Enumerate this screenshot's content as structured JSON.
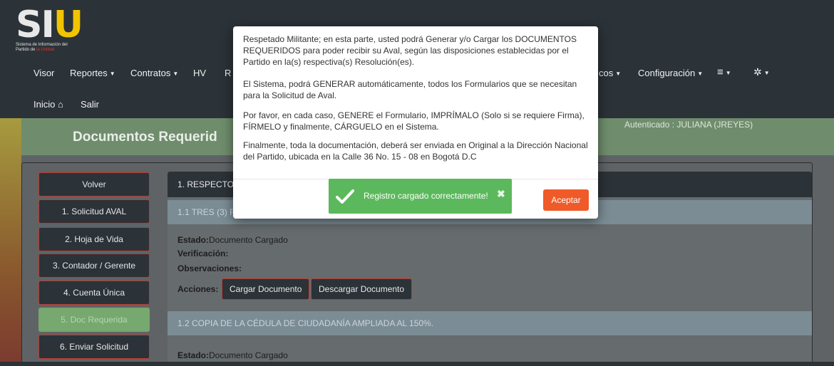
{
  "logo": {
    "letters_s": "S",
    "letters_i": "I",
    "letters_u": "U",
    "sub_line1": "Sistema de Información del",
    "sub_line2_prefix": "Partido de ",
    "sub_line2_highlight": "la Unidad"
  },
  "nav": {
    "visor": "Visor",
    "reportes": "Reportes",
    "contratos": "Contratos",
    "hv": "HV",
    "r_partial": "R",
    "cos_partial": "cos",
    "configuracion": "Configuración",
    "inicio": "Inicio",
    "salir": "Salir"
  },
  "header": {
    "title": "Documentos Requerid",
    "auth": "Autenticado : JULIANA (JREYES)"
  },
  "sidebar": {
    "items": [
      {
        "label": "Volver"
      },
      {
        "label": "1. Solicitud AVAL"
      },
      {
        "label": "2. Hoja de Vida"
      },
      {
        "label": "3. Contador / Gerente"
      },
      {
        "label": "4. Cuenta Única"
      },
      {
        "label": "5. Doc Requerida"
      },
      {
        "label": "6. Enviar Solicitud"
      }
    ]
  },
  "panel": {
    "head": "1. RESPECTO",
    "section1_title": "1.1 TRES (3) F",
    "estado_label": "Estado:",
    "estado_value": "Documento Cargado",
    "verificacion_label": "Verificación:",
    "observaciones_label": "Observaciones:",
    "acciones_label": "Acciones:",
    "cargar": "Cargar Documento",
    "descargar": "Descargar Documento",
    "section2_title": "1.2 COPIA DE LA CÉDULA DE CIUDADANÍA AMPLIADA AL 150%.",
    "estado2_label": "Estado:",
    "estado2_value": "Documento Cargado"
  },
  "modal": {
    "p1": "Respetado Militante; en esta parte, usted podrá Generar y/o Cargar los DOCUMENTOS REQUERIDOS para poder recibir su Aval, según las disposiciones establecidas por el Partido en la(s) respectiva(s) Resolución(es).",
    "p2": "El Sistema, podrá GENERAR automáticamente, todos los Formularios que se necesitan para la Solicitud de Aval.",
    "p3": "Por favor, en cada caso, GENERE el Formulario, IMPRÍMALO (Solo si se requiere Firma), FÍRMELO y finalmente, CÁRGUELO en el Sistema.",
    "p4": "Finalmente, toda la documentación, deberá ser enviada en Original a la Dirección Nacional del Partido, ubicada en la Calle 36 No. 15 - 08 en Bogotá D.C",
    "accept": "Aceptar"
  },
  "toast": {
    "message": "Registro cargado correctamente!",
    "close": "✖"
  },
  "colors": {
    "navbar": "#2b3238",
    "header_green": "#6f8d6c",
    "accent_orange": "#f05a28",
    "toast_green": "#5cb85c",
    "active_green": "#76a86f"
  },
  "icons": {
    "home": "home-icon",
    "menu": "hamburger-icon",
    "settings": "gear-icon",
    "check": "check-icon",
    "close": "close-icon"
  }
}
